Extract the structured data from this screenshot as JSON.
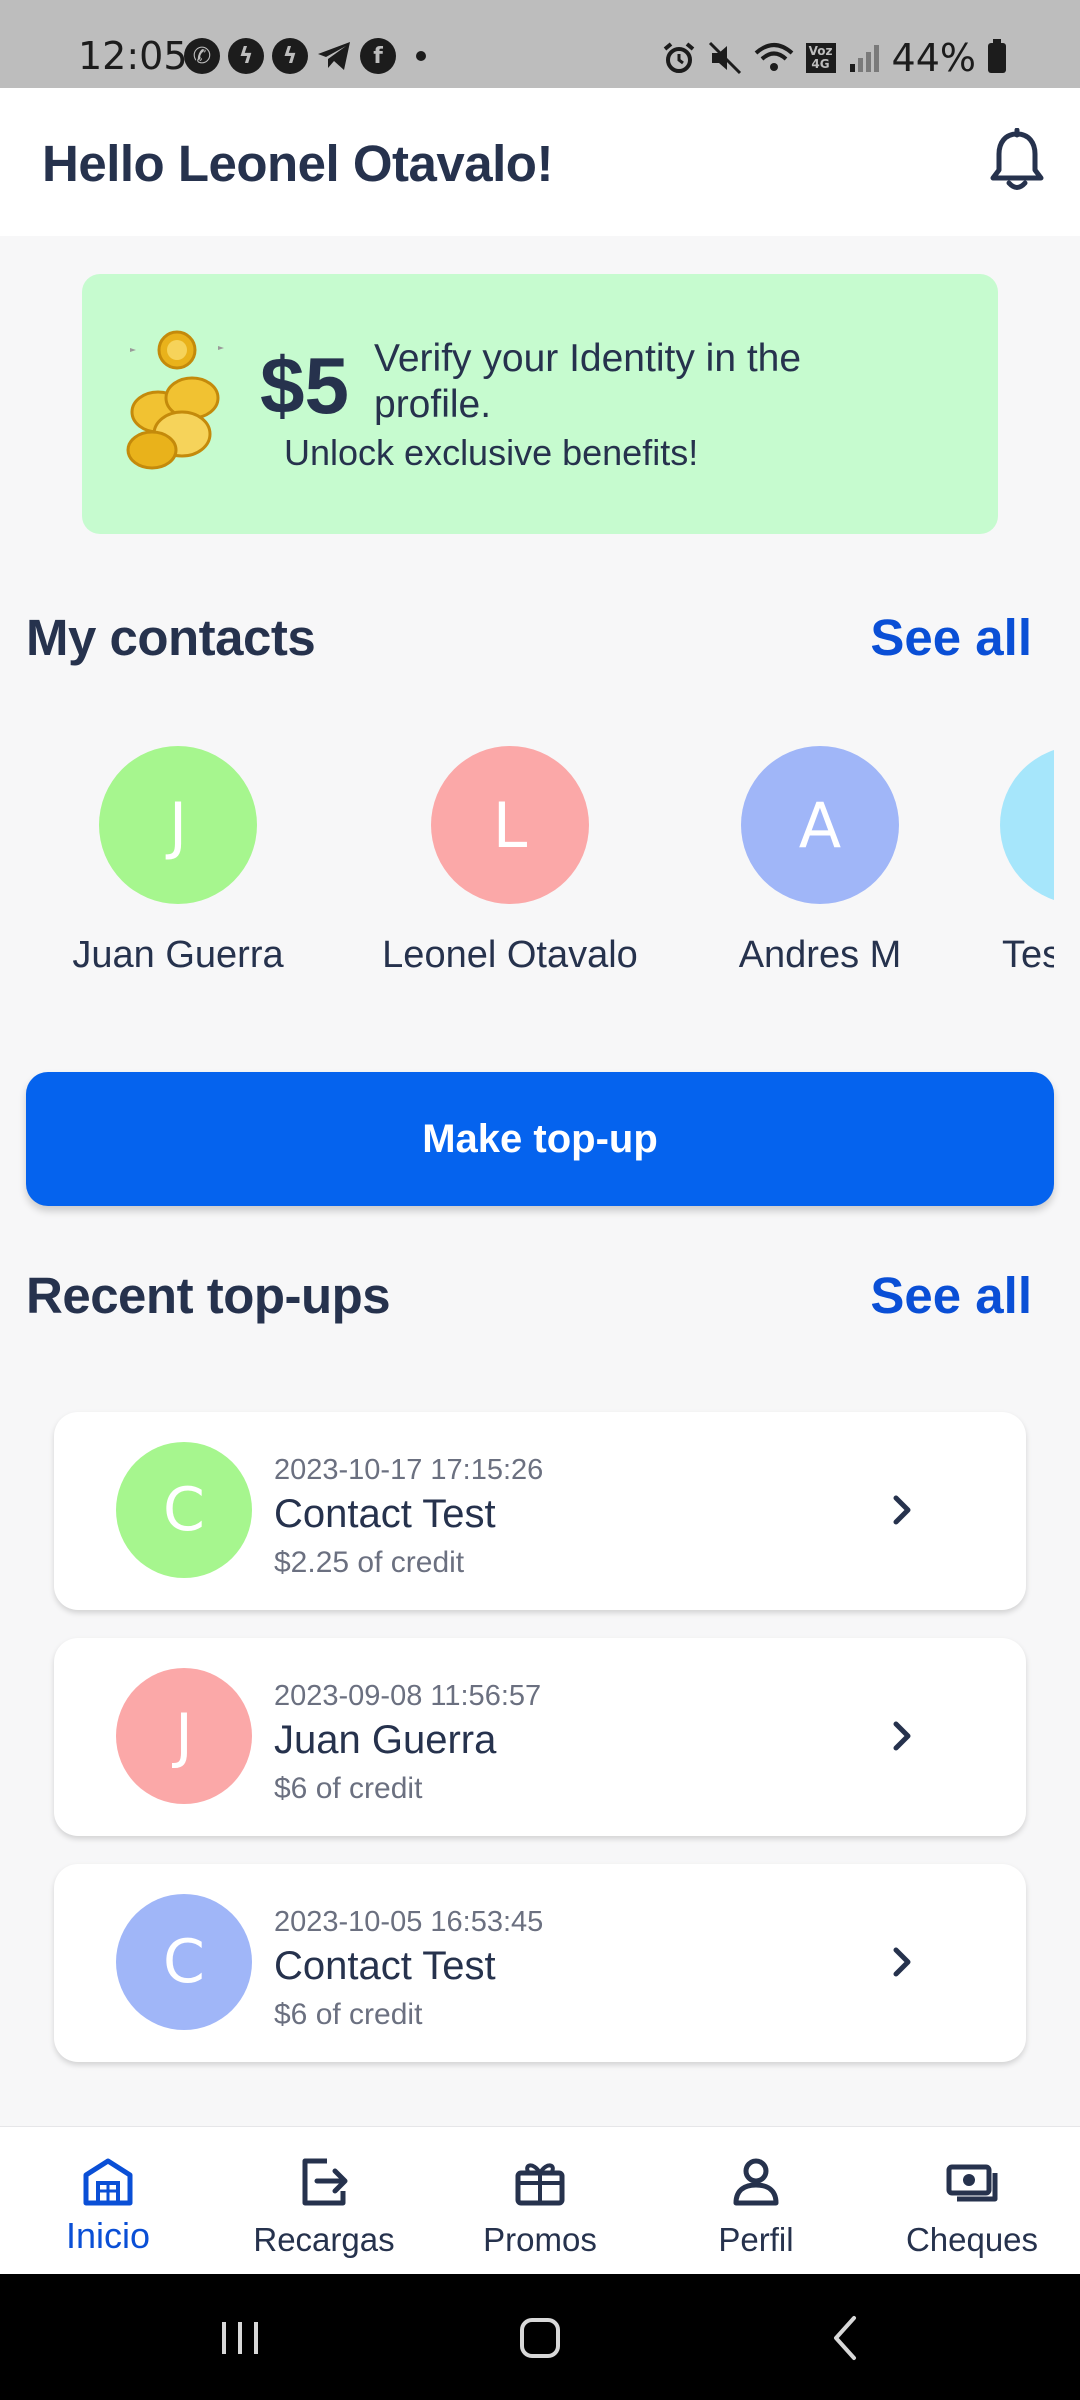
{
  "status_bar": {
    "time": "12:05",
    "battery": "44%",
    "network_label": "Voz 4G"
  },
  "header": {
    "greeting": "Hello Leonel Otavalo!",
    "bell_icon": "bell-icon"
  },
  "promo": {
    "amount": "$5",
    "title": "Verify your Identity in the profile.",
    "subtitle": "Unlock exclusive benefits!",
    "background_color": "#c6fbcf"
  },
  "contacts_section": {
    "title": "My contacts",
    "see_all_label": "See all",
    "contacts": [
      {
        "initial": "J",
        "name": "Juan Guerra",
        "color": "#a6f68e"
      },
      {
        "initial": "L",
        "name": "Leonel Otavalo",
        "color": "#fba8a8"
      },
      {
        "initial": "A",
        "name": "Andres M",
        "color": "#a0b6f8"
      },
      {
        "initial": "",
        "name": "Tes",
        "color": "#a6e6fb"
      }
    ]
  },
  "topup_button": {
    "label": "Make top-up",
    "color": "#0563ee"
  },
  "recent_section": {
    "title": "Recent top-ups",
    "see_all_label": "See all",
    "items": [
      {
        "initial": "C",
        "date": "2023-10-17 17:15:26",
        "name": "Contact Test",
        "amount": "$2.25 of credit",
        "color": "#a6f68e"
      },
      {
        "initial": "J",
        "date": "2023-09-08 11:56:57",
        "name": "Juan Guerra",
        "amount": "$6 of credit",
        "color": "#fba8a8"
      },
      {
        "initial": "C",
        "date": "2023-10-05 16:53:45",
        "name": "Contact Test",
        "amount": "$6 of credit",
        "color": "#a0b6f8"
      }
    ]
  },
  "bottom_nav": {
    "items": [
      {
        "label": "Inicio",
        "icon": "home-icon",
        "active": true
      },
      {
        "label": "Recargas",
        "icon": "transfer-icon",
        "active": false
      },
      {
        "label": "Promos",
        "icon": "gift-icon",
        "active": false
      },
      {
        "label": "Perfil",
        "icon": "user-icon",
        "active": false
      },
      {
        "label": "Cheques",
        "icon": "cash-icon",
        "active": false
      }
    ],
    "active_color": "#0a4fd6"
  }
}
